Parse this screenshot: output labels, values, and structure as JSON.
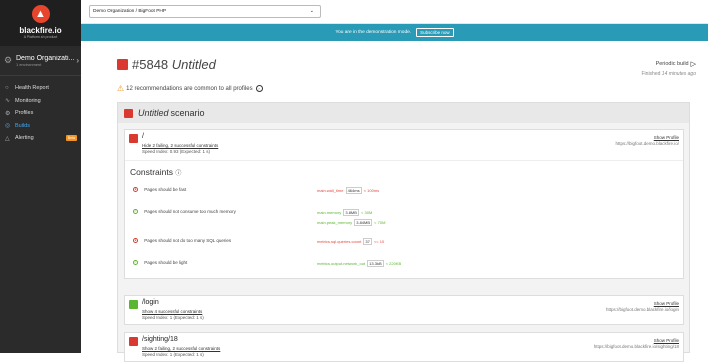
{
  "app": {
    "name": "blackfire.io",
    "tagline": "A Platform.sh product"
  },
  "sidebar": {
    "org_name": "Demo Organizati...",
    "org_sub": "1 environment",
    "items": [
      {
        "label": "Health Report",
        "icon": "shield-icon"
      },
      {
        "label": "Monitoring",
        "icon": "pulse-icon"
      },
      {
        "label": "Profiles",
        "icon": "gear-icon"
      },
      {
        "label": "Builds",
        "icon": "builds-icon",
        "active": true
      },
      {
        "label": "Alerting",
        "icon": "bell-icon",
        "badge": "Beta"
      }
    ]
  },
  "topbar": {
    "org_select": "Demo Organization / BigFoot PHP"
  },
  "demo_bar": {
    "text": "You are in the demonstration mode.",
    "subscribe": "Subscribe now"
  },
  "build": {
    "number": "#5848",
    "name": "Untitled",
    "periodic": "Periodic build",
    "finished_prefix": "Finished",
    "finished_ago": "14 minutes ago",
    "recommendations": "12 recommendations are common to all profiles",
    "colors": {
      "fail": "#d9392e",
      "pass": "#5bb531",
      "accent": "#3fa9f5",
      "banner": "#2a9bb7"
    }
  },
  "scenario": {
    "name": "Untitled",
    "suffix": "scenario",
    "cards": [
      {
        "path": "/",
        "status": "fail",
        "link": "Hide 2 failing, 2 successful constraints",
        "speed": "Speed Index: 0.93 (Expected: 1 s)",
        "show_profile": "Show Profile",
        "url": "https://bigfoot.demo.blackfire.io/"
      },
      {
        "path": "/login",
        "status": "pass",
        "link": "Show 4 successful constraints",
        "speed": "Speed Index: 1 (Expected: 1 s)",
        "show_profile": "Show Profile",
        "url": "https://bigfoot.demo.blackfire.io/login"
      },
      {
        "path": "/sighting/18",
        "status": "fail",
        "link": "Show 2 failing, 2 successful constraints",
        "speed": "Speed Index: 1 (Expected: 1 s)",
        "show_profile": "Show Profile",
        "url": "https://bigfoot.demo.blackfire.io/sighting/18"
      }
    ],
    "constraints_title": "Constraints",
    "constraints": [
      {
        "label": "Pages should be fast",
        "status": "fail",
        "metric": "main.wall_time",
        "value": "464ms",
        "expect": "< 100ms"
      },
      {
        "label": "Pages should not consume too much memory",
        "status": "ok",
        "metric": "main.memory",
        "value": "3.8MB",
        "expect": "< 30M",
        "metric2": "main.peak_memory",
        "value2": "3.84MB",
        "expect2": "< 70M"
      },
      {
        "label": "Pages should not do too many SQL queries",
        "status": "fail",
        "metric": "metrics.sql.queries.count",
        "value": "37",
        "expect": "<= 10"
      },
      {
        "label": "Pages should be light",
        "status": "ok",
        "metric": "metrics.output.network_out",
        "value": "13.3kB",
        "expect": "< 220KB"
      }
    ]
  }
}
